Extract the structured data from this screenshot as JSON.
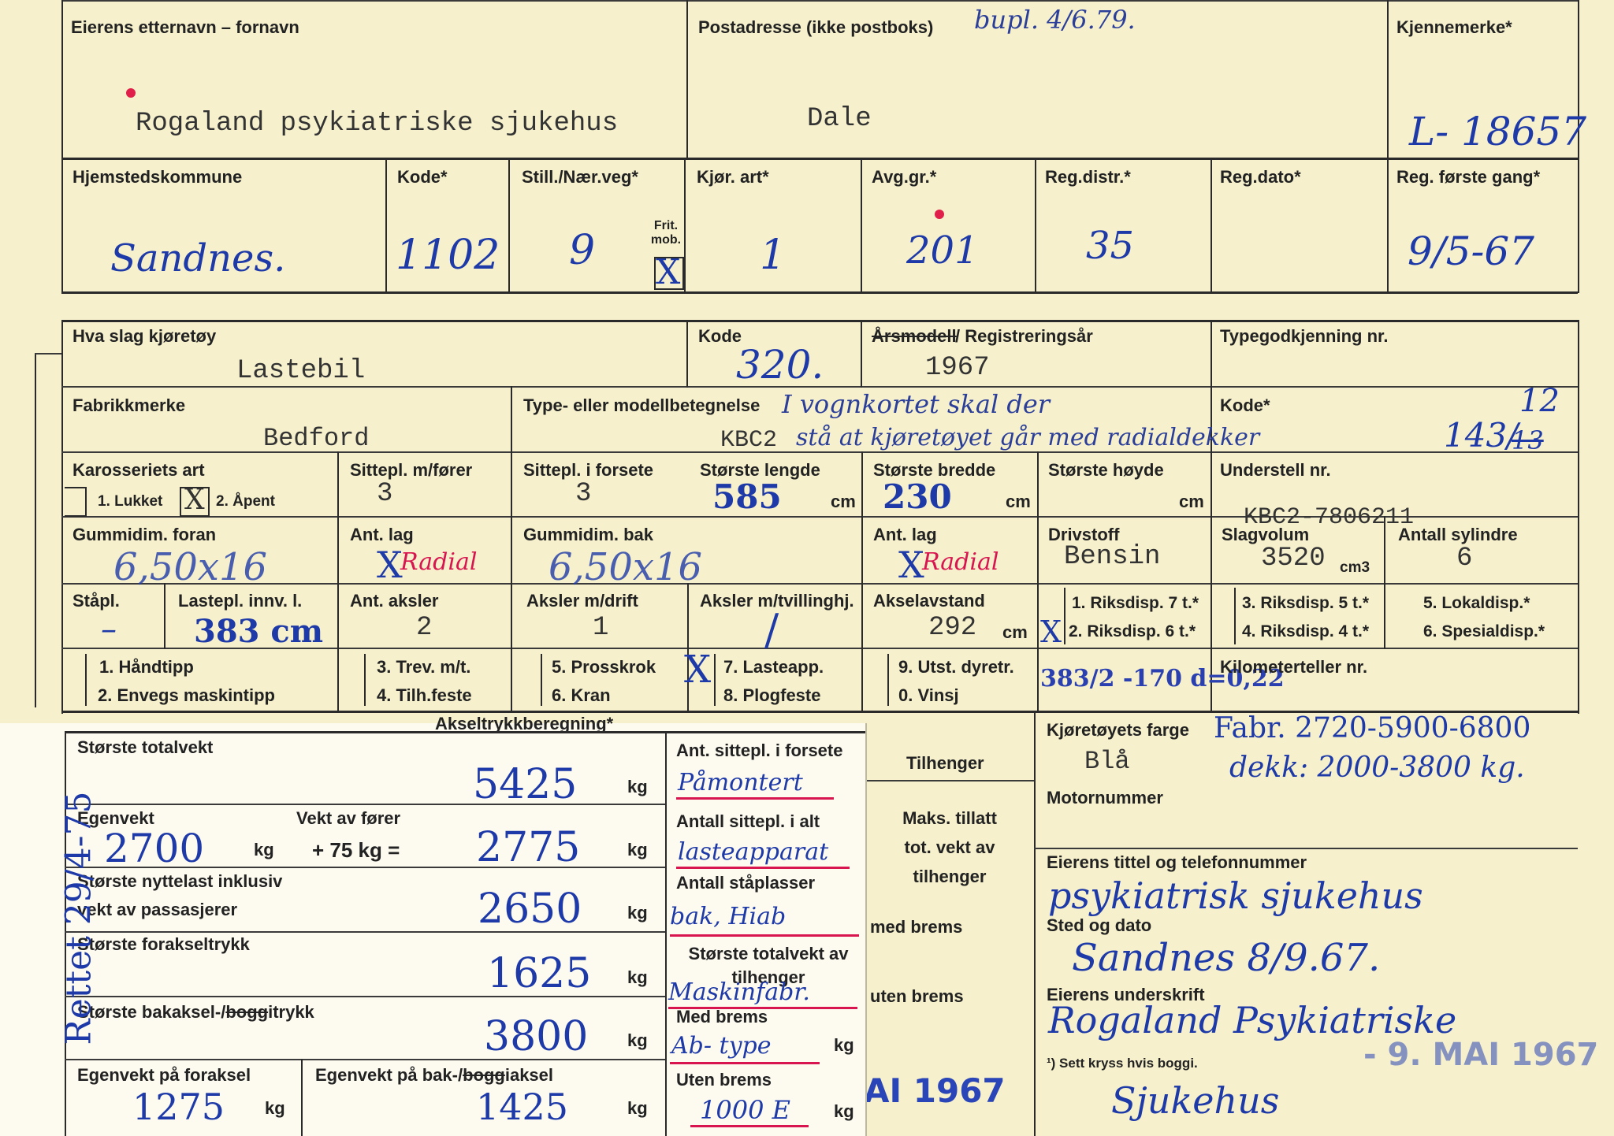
{
  "header": {
    "owner_name_label": "Eierens etternavn – fornavn",
    "owner_name": "Rogaland psykiatriske sjukehus",
    "postal_label": "Postadresse (ikke postboks)",
    "postal_note": "bupl. 4/6.79.",
    "postal_value": "Dale",
    "reg_mark_label": "Kjennemerke*",
    "reg_mark": "L- 18657"
  },
  "row2": {
    "municipality_label": "Hjemstedskommune",
    "municipality": "Sandnes.",
    "code_label": "Kode*",
    "code": "1102",
    "still_label": "Still./Nær.veg*",
    "still": "9",
    "fritt_label": "Frit. mob.",
    "fritt_mark": "X",
    "kjor_label": "Kjør. art*",
    "kjor": "1",
    "avg_label": "Avg.gr.*",
    "avg": "201",
    "regdistr_label": "Reg.distr.*",
    "regdistr": "35",
    "regdato_label": "Reg.dato*",
    "regdato": "",
    "regfirst_label": "Reg. første gang*",
    "regfirst": "9/5-67"
  },
  "vehicle": {
    "kind_label": "Hva slag kjøretøy",
    "kind": "Lastebil",
    "kode_label": "Kode",
    "kode": "320.",
    "year_label_struck": "Årsmodell",
    "year_label": "/ Registreringsår",
    "year": "1967",
    "typegodk_label": "Typegodkjenning nr.",
    "make_label": "Fabrikkmerke",
    "make": "Bedford",
    "model_label": "Type- eller modellbetegnelse",
    "model": "KBC2",
    "model_note_1": "I vognkortet skal der",
    "model_note_2": "stå at kjøretøyet går med radialdekker",
    "kode2_label": "Kode*",
    "kode2": "143/",
    "kode2_struck": "13",
    "kode2_new": "12",
    "karosseri_label": "Karosseriets art",
    "opt_lukket": "1. Lukket",
    "opt_apent": "2. Åpent",
    "apent_mark": "X",
    "sitte_forer_label": "Sittepl. m/fører",
    "sitte_forer": "3",
    "sitte_forsete_label": "Sittepl. i forsete",
    "sitte_forsete": "3",
    "lengde_label": "Største lengde",
    "lengde": "585",
    "cm": "cm",
    "bredde_label": "Største bredde",
    "bredde": "230",
    "hoyde_label": "Største høyde",
    "understell_label": "Understell nr.",
    "understell": "KBC2-7806211",
    "gummi_foran_label": "Gummidim. foran",
    "gummi_foran": "6,50x16",
    "ant_lag_label": "Ant. lag",
    "ant_lag": "X",
    "radial": "Radial",
    "gummi_bak_label": "Gummidim. bak",
    "gummi_bak": "6,50x16",
    "drivstoff_label": "Drivstoff",
    "drivstoff": "Bensin",
    "slagvolum_label": "Slagvolum",
    "slagvolum": "3520",
    "cm3": "cm3",
    "sylindre_label": "Antall sylindre",
    "sylindre": "6",
    "stapl_label": "Ståpl.",
    "stapl": "–",
    "lastepl_label": "Lastepl. innv. l.",
    "lastepl": "383 cm",
    "aksler_label": "Ant. aksler",
    "aksler": "2",
    "aksler_drift_label": "Aksler m/drift",
    "aksler_drift": "1",
    "aksler_tv_label": "Aksler m/tvillinghj.",
    "aksler_tv": "/",
    "akselavstand_label": "Akselavstand",
    "akselavstand": "292",
    "akselavstand_unit": "cm",
    "riks1": "1. Riksdisp. 7 t.*",
    "riks2": "2. Riksdisp. 6 t.*",
    "riks2_mark": "X",
    "riks3": "3. Riksdisp. 5 t.*",
    "riks4": "4. Riksdisp. 4 t.*",
    "lokal5": "5. Lokaldisp.*",
    "spes6": "6. Spesialdisp.*",
    "opt_handtipp": "1. Håndtipp",
    "opt_envegs": "2. Envegs maskintipp",
    "opt_trev": "3. Trev. m/t.",
    "opt_tilh": "4. Tilh.feste",
    "opt_prosskrok": "5. Prosskrok",
    "opt_kran": "6. Kran",
    "opt_lasteapp": "7. Lasteapp.",
    "opt_plogfeste": "8. Plogfeste",
    "lasteapp_mark": "X",
    "opt_utst": "9. Utst. dyretr.",
    "opt_vinsj": "0. Vinsj",
    "calc_note": "383/2 -170 d=0,22",
    "km_label": "Kilometerteller nr."
  },
  "weights": {
    "heading": "Akseltrykkberegning*",
    "total_label": "Største totalvekt",
    "total": "5425",
    "kg": "kg",
    "egen_label": "Egenvekt",
    "egen": "2700",
    "forer_label": "Vekt av fører",
    "forer_expr": "+ 75 kg =",
    "egen_forer": "2775",
    "nytte_label": "Største nyttelast inklusiv",
    "nytte_label2": "vekt av passasjerer",
    "nytte": "2650",
    "forak_label": "Største forakseltrykk",
    "forak": "1625",
    "bak_label_a": "Største bakaksel-/",
    "bak_label_struck": "bogg",
    "bak_label_b": "itrykk",
    "bak": "3800",
    "egen_for_label": "Egenvekt på foraksel",
    "egen_for": "1275",
    "egen_bak_label": "Egenvekt på bak-/",
    "egen_bak_struck": "bogg",
    "egen_bak_label_b": "iaksel",
    "egen_bak": "1425"
  },
  "middle_col": {
    "forsete_label": "Ant. sittepl. i forsete",
    "forsete_val": "Påmontert",
    "sittepl_alt_label": "Antall sittepl. i alt",
    "sittepl_alt_val": "lasteapparat",
    "staapl_label": "Antall ståplasser",
    "staapl_val": "bak, Hiab",
    "tot_tilh_label": "Største totalvekt av tilhenger",
    "tot_tilh_val": "Maskinfabr.",
    "med_brems_label": "Med brems",
    "med_brems_val": "Ab- type",
    "kg": "kg",
    "uten_brems_label": "Uten brems",
    "uten_brems_val": "1000 E"
  },
  "tilhenger": {
    "heading": "Tilhenger",
    "maks_label": "Maks. tillatt tot. vekt av tilhenger",
    "med_brems": "med brems",
    "uten_brems": "uten brems",
    "stamp": "AI 1967"
  },
  "right": {
    "farge_label": "Kjøretøyets farge",
    "farge": "Blå",
    "farge_note1": "Fabr. 2720-5900-6800",
    "farge_note2": "dekk: 2000-3800 kg.",
    "motor_label": "Motornummer",
    "tittel_label": "Eierens tittel og telefonnummer",
    "tittel": "psykiatrisk sjukehus",
    "sted_label": "Sted og dato",
    "sted": "Sandnes 8/9.67.",
    "sign_label": "Eierens underskrift",
    "sign1": "Rogaland Psykiatriske",
    "sign2": "Sjukehus",
    "footnote": "¹) Sett kryss hvis boggi.",
    "date_stamp": "- 9. MAI 1967"
  },
  "margin_note": "Rettet 29/4-75"
}
